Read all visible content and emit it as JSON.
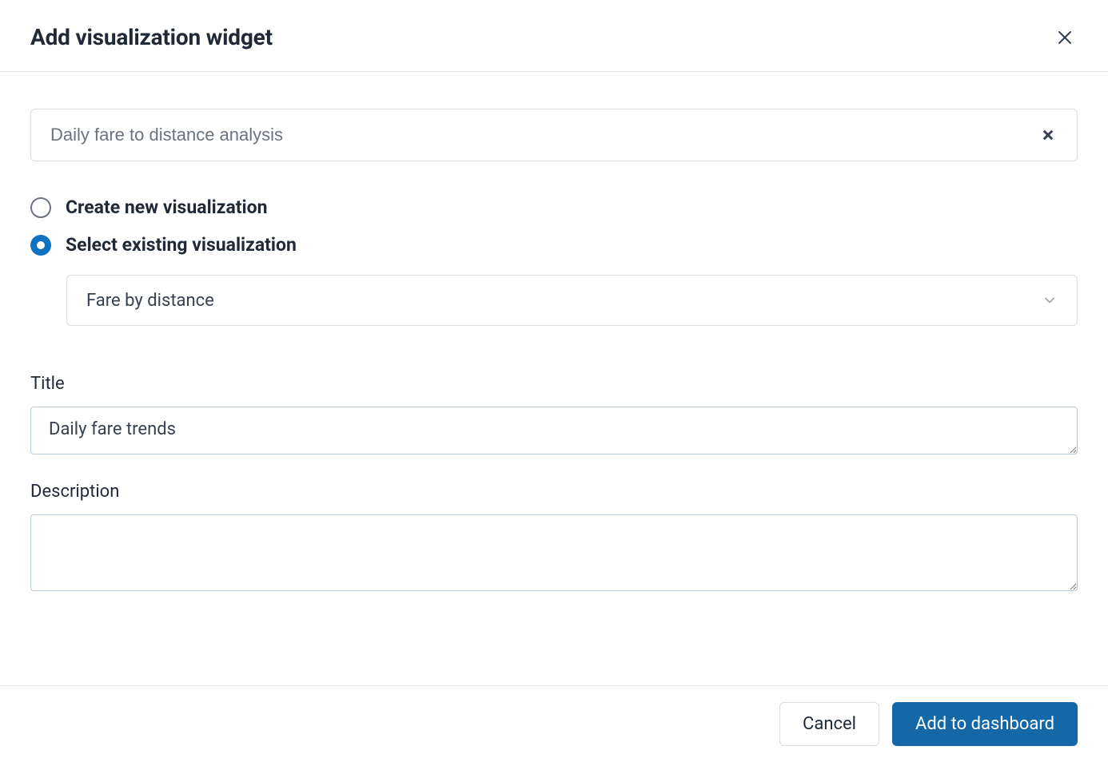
{
  "header": {
    "title": "Add visualization widget"
  },
  "search": {
    "value": "Daily fare to distance analysis"
  },
  "radios": {
    "create_label": "Create new visualization",
    "select_label": "Select existing visualization",
    "selected": "select"
  },
  "visualization_select": {
    "value": "Fare by distance"
  },
  "fields": {
    "title_label": "Title",
    "title_value": "Daily fare trends",
    "description_label": "Description",
    "description_value": ""
  },
  "footer": {
    "cancel_label": "Cancel",
    "submit_label": "Add to dashboard"
  }
}
